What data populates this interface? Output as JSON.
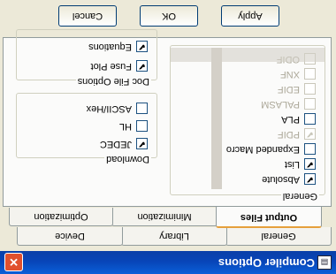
{
  "window": {
    "title": "Compiler Options",
    "close_label": "✕",
    "icon_label": "▤"
  },
  "tabs_row_back": [
    {
      "label": "General"
    },
    {
      "label": "Library"
    },
    {
      "label": "Device"
    }
  ],
  "tabs_row_front": [
    {
      "label": "Output Files",
      "active": true
    },
    {
      "label": "Minimization"
    },
    {
      "label": "Optimization"
    }
  ],
  "download": {
    "title": "Download",
    "items": [
      {
        "label": "JEDEC",
        "checked": true
      },
      {
        "label": "HL",
        "checked": false
      },
      {
        "label": "ASCII/Hex",
        "checked": false
      }
    ]
  },
  "doc_file_options": {
    "title": "Doc File Options",
    "items": [
      {
        "label": "Fuse Plot",
        "checked": true
      },
      {
        "label": "Equations",
        "checked": true
      }
    ]
  },
  "general": {
    "title": "General",
    "items": [
      {
        "label": "Absolute",
        "checked": true,
        "enabled": true
      },
      {
        "label": "List",
        "checked": true,
        "enabled": true
      },
      {
        "label": "Expanded Macro",
        "checked": false,
        "enabled": true
      },
      {
        "label": "PDIF",
        "checked": true,
        "enabled": false
      },
      {
        "label": "PLA",
        "checked": false,
        "enabled": true
      },
      {
        "label": "PALASM",
        "checked": false,
        "enabled": false
      },
      {
        "label": "EDIF",
        "checked": false,
        "enabled": false
      },
      {
        "label": "XNF",
        "checked": false,
        "enabled": false
      },
      {
        "label": "ODIF",
        "checked": false,
        "enabled": false
      }
    ]
  },
  "buttons": {
    "apply": "Apply",
    "ok": "OK",
    "cancel": "Cancel"
  },
  "colors": {
    "titlebar": "#0a5fd8",
    "active_tab_accent": "#e6a03c",
    "close": "#e1502d"
  }
}
